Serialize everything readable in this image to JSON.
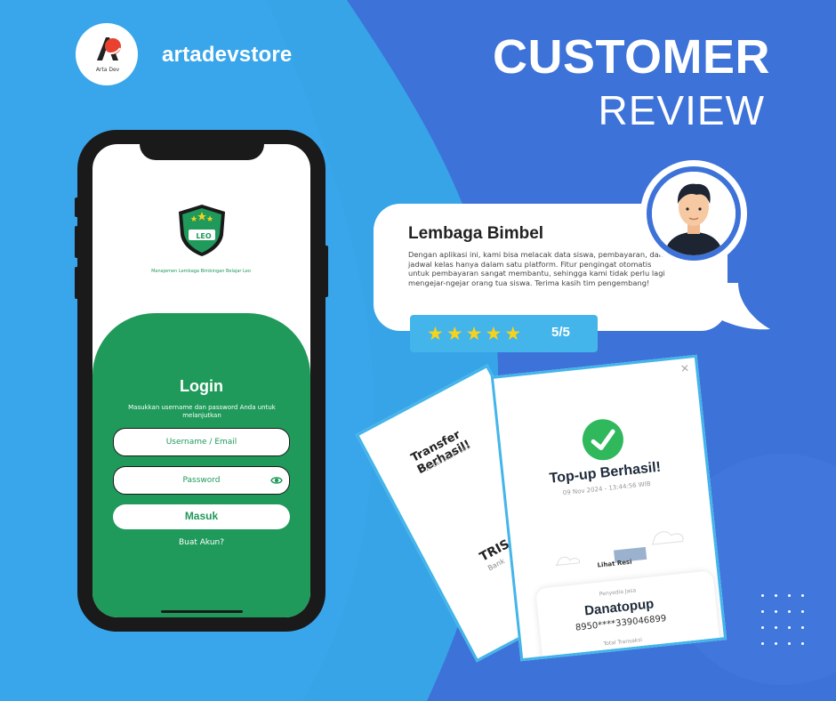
{
  "brand": {
    "name": "artadevstore",
    "logo_text": "Arta Dev",
    "logo_icon": "arta-dev-logo-icon"
  },
  "headline": {
    "line1": "CUSTOMER",
    "line2": "REVIEW"
  },
  "phone_app": {
    "logo_icon": "leo-shield-logo-icon",
    "logo_text": "LEO",
    "app_name": "Manajemen Lembaga Bimbingan Belajar Leo",
    "login_title": "Login",
    "login_subtitle": "Masukkan username dan password Anda untuk melanjutkan",
    "username_placeholder": "Username / Email",
    "password_placeholder": "Password",
    "password_icon": "eye-icon",
    "submit_label": "Masuk",
    "register_link": "Buat Akun?"
  },
  "review": {
    "reviewer": "Lembaga Bimbel",
    "text": "Dengan aplikasi ini, kami bisa melacak data siswa, pembayaran, dan jadwal kelas hanya dalam satu platform. Fitur pengingat otomatis untuk pembayaran sangat membantu, sehingga kami tidak perlu lagi mengejar-ngejar orang tua siswa. Terima kasih tim pengembang!",
    "stars": 5,
    "score_text": "5/5",
    "avatar_icon": "man-avatar-icon"
  },
  "receipt_back": {
    "title": "Transfer Berhasil!",
    "date": "25 Okt 2024 · 18:0",
    "recipient": "TRIS",
    "bank": "Bank"
  },
  "receipt_front": {
    "title": "Top-up Berhasil!",
    "date": "09 Nov 2024 - 13:44:56 WIB",
    "view_receipt": "Lihat Resi",
    "provider_label": "Penyedia Jasa",
    "provider": "Danatopup",
    "account": "8950****339046899",
    "total_label": "Total Transaksi",
    "check_icon": "check-circle-icon",
    "close_icon": "close-icon"
  },
  "colors": {
    "bg_left": "#3aa6ea",
    "bg_right": "#3f6fd8",
    "green": "#1f9a5a",
    "accent": "#43b5ea",
    "star": "#f7d21b"
  }
}
